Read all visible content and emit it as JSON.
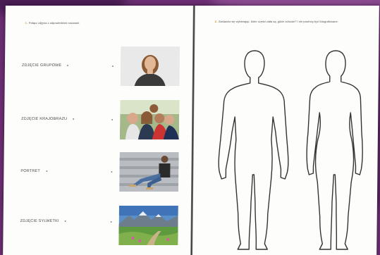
{
  "left_page": {
    "instruction_number": "1.",
    "instruction_text": "Połącz zdjęcia z odpowiednimi nazwami.",
    "labels": [
      "ZDJĘCIE GRUPOWE",
      "ZDJĘCIE KRAJOBRAZU",
      "PORTRET",
      "ZDJĘCIE SYLWETKI"
    ],
    "photos": [
      {
        "subject": "woman-portrait"
      },
      {
        "subject": "group-of-friends"
      },
      {
        "subject": "person-sitting-on-steps"
      },
      {
        "subject": "mountain-landscape"
      }
    ]
  },
  "right_page": {
    "instruction_number": "2.",
    "instruction_text": "Zastanów się wybierając, które części ciała są, gdzie zdrowie? I nie powinny być fotografowane."
  },
  "colors": {
    "background": "#6b2e72",
    "paper": "#fdfdfb",
    "accent": "#c79a2e",
    "outline": "#333333"
  }
}
